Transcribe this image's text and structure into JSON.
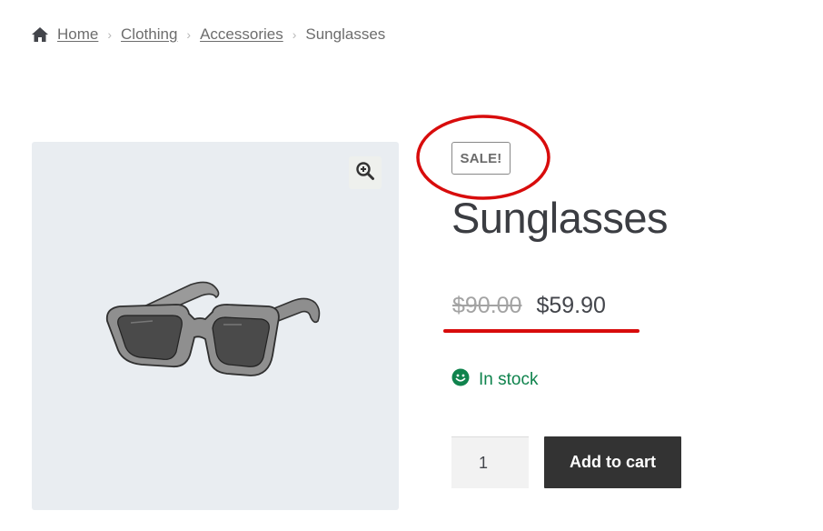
{
  "breadcrumb": {
    "home": "Home",
    "items": [
      "Clothing",
      "Accessories"
    ],
    "current": "Sunglasses"
  },
  "product": {
    "badge": "SALE!",
    "title": "Sunglasses",
    "price_old": "$90.00",
    "price_new": "$59.90",
    "stock": "In stock",
    "quantity": "1",
    "add_to_cart": "Add to cart"
  },
  "icons": {
    "home": "home-icon",
    "separator": "chevron-right-icon",
    "zoom": "zoom-in-icon",
    "stock": "smiley-icon"
  },
  "colors": {
    "accent_annotation": "#d80c0c",
    "stock_green": "#0f834d",
    "button_dark": "#333333",
    "gallery_bg": "#e9edf1"
  }
}
